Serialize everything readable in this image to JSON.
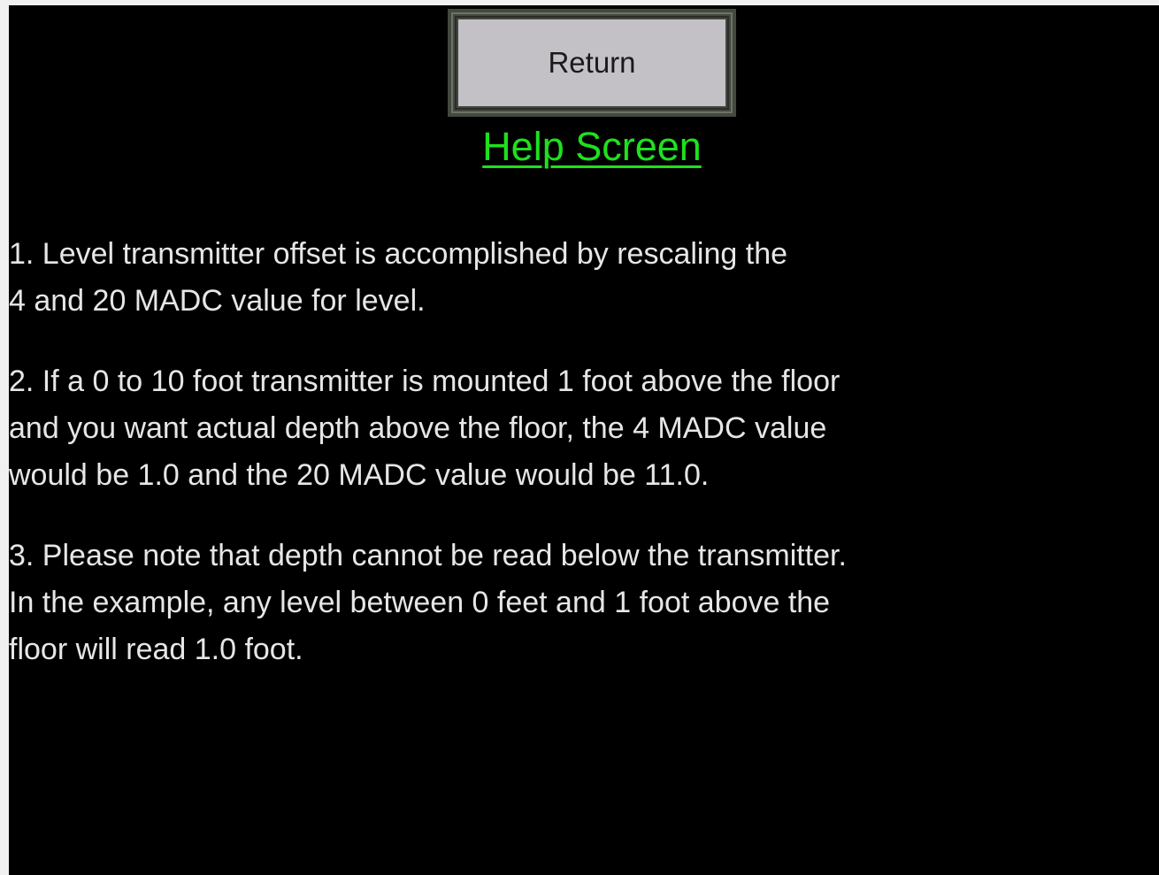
{
  "header": {
    "return_label": "Return",
    "title": "Help Screen"
  },
  "content": {
    "paragraphs": [
      "1. Level transmitter offset is accomplished by rescaling the\n4 and 20 MADC value for level.",
      "2. If a 0 to 10 foot transmitter is mounted 1 foot above the floor\nand you want actual depth above the floor, the 4 MADC value\nwould be 1.0 and the 20 MADC value would be 11.0.",
      "3. Please note that depth cannot be read below the transmitter.\nIn the example, any level between 0 feet and 1 foot above the\nfloor will read 1.0 foot."
    ]
  },
  "colors": {
    "background": "#000000",
    "title": "#1ee11e",
    "text": "#e6e6e6",
    "button_face": "#c4c1c6",
    "button_border": "#44483f"
  }
}
